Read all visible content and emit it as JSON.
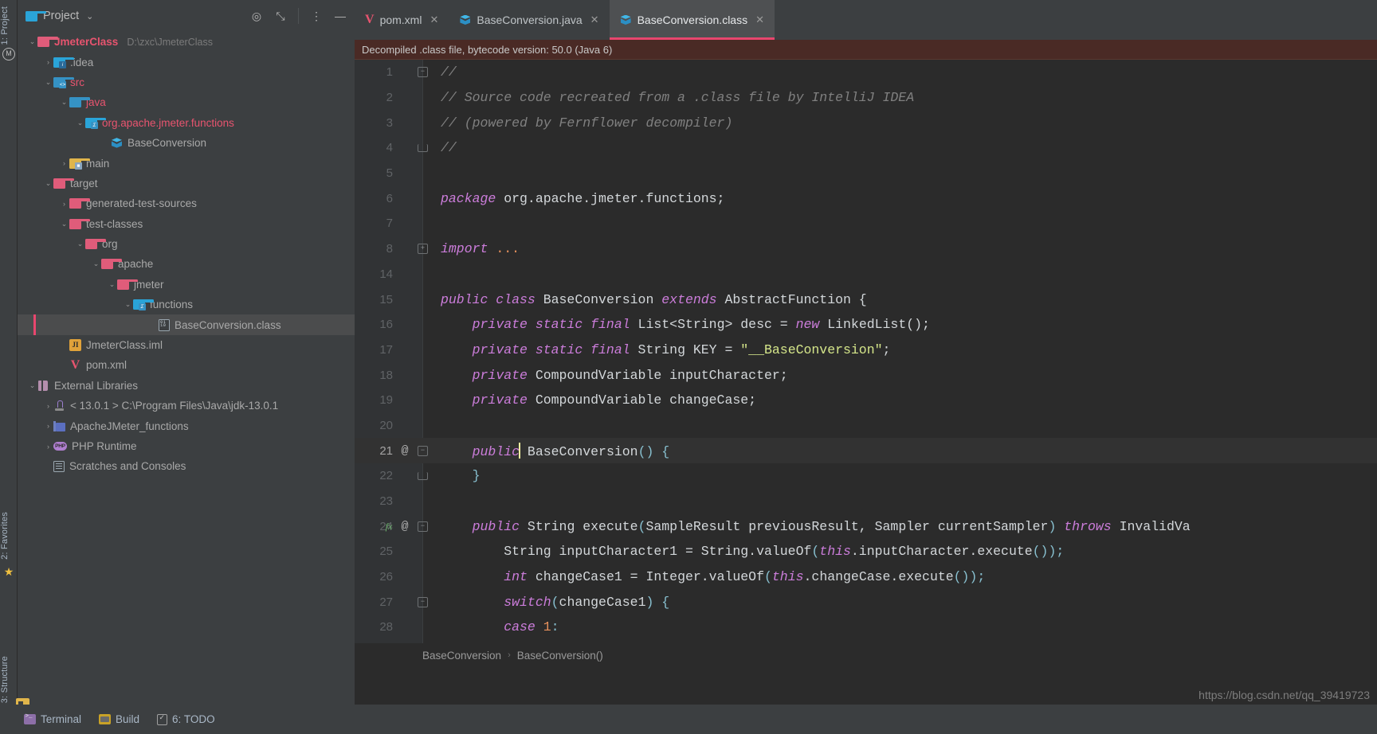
{
  "window": {
    "left_tools": [
      {
        "label": "1: Project",
        "name": "project"
      },
      {
        "label": "2: Favorites",
        "name": "favorites"
      },
      {
        "label": "3: Structure",
        "name": "structure"
      }
    ]
  },
  "project_panel": {
    "title": "Project",
    "actions": {
      "locate": "◎",
      "collapse": "⤡",
      "more": "⋮",
      "minimize": "—"
    },
    "tree": [
      {
        "label": "JmeterClass",
        "sub": "D:\\zxc\\JmeterClass",
        "arrow": "⌄",
        "indent": 12,
        "icon": "folder-pink-outline",
        "style": "red-bold",
        "selected": false
      },
      {
        "label": ".idea",
        "sub": "",
        "arrow": "›",
        "indent": 32,
        "icon": "folder-idea",
        "style": "grey",
        "selected": false
      },
      {
        "label": "src",
        "sub": "",
        "arrow": "⌄",
        "indent": 32,
        "icon": "folder-source",
        "style": "red",
        "selected": false
      },
      {
        "label": "java",
        "sub": "",
        "arrow": "⌄",
        "indent": 52,
        "icon": "folder-blue",
        "style": "red",
        "selected": false
      },
      {
        "label": "org.apache.jmeter.functions",
        "sub": "",
        "arrow": "⌄",
        "indent": 72,
        "icon": "folder-package",
        "style": "red",
        "selected": false
      },
      {
        "label": "BaseConversion",
        "sub": "",
        "arrow": "",
        "indent": 104,
        "icon": "java-class-cube",
        "style": "grey",
        "selected": false
      },
      {
        "label": "main",
        "sub": "",
        "arrow": "›",
        "indent": 52,
        "icon": "folder-test-yellow",
        "style": "grey",
        "selected": false
      },
      {
        "label": "target",
        "sub": "",
        "arrow": "⌄",
        "indent": 32,
        "icon": "folder-pink",
        "style": "grey",
        "selected": false
      },
      {
        "label": "generated-test-sources",
        "sub": "",
        "arrow": "›",
        "indent": 52,
        "icon": "folder-pink",
        "style": "grey",
        "selected": false
      },
      {
        "label": "test-classes",
        "sub": "",
        "arrow": "⌄",
        "indent": 52,
        "icon": "folder-pink",
        "style": "grey",
        "selected": false
      },
      {
        "label": "org",
        "sub": "",
        "arrow": "⌄",
        "indent": 72,
        "icon": "folder-pink",
        "style": "grey",
        "selected": false
      },
      {
        "label": "apache",
        "sub": "",
        "arrow": "⌄",
        "indent": 92,
        "icon": "folder-pink",
        "style": "grey",
        "selected": false
      },
      {
        "label": "jmeter",
        "sub": "",
        "arrow": "⌄",
        "indent": 112,
        "icon": "folder-pink",
        "style": "grey",
        "selected": false
      },
      {
        "label": "functions",
        "sub": "",
        "arrow": "⌄",
        "indent": 132,
        "icon": "folder-package",
        "style": "grey",
        "selected": false
      },
      {
        "label": "BaseConversion.class",
        "sub": "",
        "arrow": "",
        "indent": 164,
        "icon": "class-binary",
        "style": "grey",
        "selected": true
      },
      {
        "label": "JmeterClass.iml",
        "sub": "",
        "arrow": "",
        "indent": 52,
        "icon": "iml-file",
        "style": "grey",
        "selected": false
      },
      {
        "label": "pom.xml",
        "sub": "",
        "arrow": "",
        "indent": 52,
        "icon": "maven-pom",
        "style": "grey",
        "selected": false
      },
      {
        "label": "External Libraries",
        "sub": "",
        "arrow": "⌄",
        "indent": 12,
        "icon": "library-book",
        "style": "grey",
        "selected": false
      },
      {
        "label": "< 13.0.1 >  C:\\Program Files\\Java\\jdk-13.0.1",
        "sub": "",
        "arrow": "›",
        "indent": 32,
        "icon": "jdk-coffee",
        "style": "grey",
        "selected": false
      },
      {
        "label": "ApacheJMeter_functions",
        "sub": "",
        "arrow": "›",
        "indent": 32,
        "icon": "library-blue",
        "style": "grey",
        "selected": false
      },
      {
        "label": "PHP Runtime",
        "sub": "",
        "arrow": "›",
        "indent": 32,
        "icon": "php-runtime",
        "style": "grey",
        "selected": false
      },
      {
        "label": "Scratches and Consoles",
        "sub": "",
        "arrow": "",
        "indent": 32,
        "icon": "scratch-file",
        "style": "grey",
        "selected": false
      }
    ]
  },
  "editor": {
    "tabs": [
      {
        "label": "pom.xml",
        "icon": "maven-icon",
        "active": false,
        "close": "✕"
      },
      {
        "label": "BaseConversion.java",
        "icon": "java-class-icon",
        "active": false,
        "close": "✕"
      },
      {
        "label": "BaseConversion.class",
        "icon": "java-class-icon",
        "active": true,
        "close": "✕"
      }
    ],
    "notice": "Decompiled .class file, bytecode version: 50.0 (Java 6)",
    "lines": [
      {
        "num": "1",
        "gutter_at": false,
        "gutter_override": false,
        "fold": "start",
        "current": false,
        "tokens": [
          {
            "t": "cm",
            "v": "//"
          }
        ]
      },
      {
        "num": "2",
        "gutter_at": false,
        "gutter_override": false,
        "fold": "",
        "current": false,
        "tokens": [
          {
            "t": "cm",
            "v": "// Source code recreated from a .class file by IntelliJ IDEA"
          }
        ]
      },
      {
        "num": "3",
        "gutter_at": false,
        "gutter_override": false,
        "fold": "",
        "current": false,
        "tokens": [
          {
            "t": "cm",
            "v": "// (powered by Fernflower decompiler)"
          }
        ]
      },
      {
        "num": "4",
        "gutter_at": false,
        "gutter_override": false,
        "fold": "end",
        "current": false,
        "tokens": [
          {
            "t": "cm",
            "v": "//"
          }
        ]
      },
      {
        "num": "5",
        "gutter_at": false,
        "gutter_override": false,
        "fold": "",
        "current": false,
        "tokens": []
      },
      {
        "num": "6",
        "gutter_at": false,
        "gutter_override": false,
        "fold": "",
        "current": false,
        "tokens": [
          {
            "t": "k",
            "v": "package"
          },
          {
            "t": "t",
            "v": " org.apache.jmeter.functions;"
          }
        ]
      },
      {
        "num": "7",
        "gutter_at": false,
        "gutter_override": false,
        "fold": "",
        "current": false,
        "tokens": []
      },
      {
        "num": "8",
        "gutter_at": false,
        "gutter_override": false,
        "fold": "plus",
        "current": false,
        "tokens": [
          {
            "t": "k",
            "v": "import"
          },
          {
            "t": "t",
            "v": " "
          },
          {
            "t": "n",
            "v": "..."
          }
        ]
      },
      {
        "num": "14",
        "gutter_at": false,
        "gutter_override": false,
        "fold": "",
        "current": false,
        "tokens": []
      },
      {
        "num": "15",
        "gutter_at": false,
        "gutter_override": false,
        "fold": "",
        "current": false,
        "tokens": [
          {
            "t": "k",
            "v": "public class"
          },
          {
            "t": "t",
            "v": " BaseConversion "
          },
          {
            "t": "k",
            "v": "extends"
          },
          {
            "t": "t",
            "v": " AbstractFunction {"
          }
        ]
      },
      {
        "num": "16",
        "gutter_at": false,
        "gutter_override": false,
        "fold": "",
        "current": false,
        "tokens": [
          {
            "t": "t",
            "v": "    "
          },
          {
            "t": "k",
            "v": "private static final"
          },
          {
            "t": "t",
            "v": " List<String> desc = "
          },
          {
            "t": "k",
            "v": "new"
          },
          {
            "t": "t",
            "v": " LinkedList();"
          }
        ]
      },
      {
        "num": "17",
        "gutter_at": false,
        "gutter_override": false,
        "fold": "",
        "current": false,
        "tokens": [
          {
            "t": "t",
            "v": "    "
          },
          {
            "t": "k",
            "v": "private static final"
          },
          {
            "t": "t",
            "v": " String KEY = "
          },
          {
            "t": "s",
            "v": "\"__BaseConversion\""
          },
          {
            "t": "t",
            "v": ";"
          }
        ]
      },
      {
        "num": "18",
        "gutter_at": false,
        "gutter_override": false,
        "fold": "",
        "current": false,
        "tokens": [
          {
            "t": "t",
            "v": "    "
          },
          {
            "t": "k",
            "v": "private"
          },
          {
            "t": "t",
            "v": " CompoundVariable inputCharacter;"
          }
        ]
      },
      {
        "num": "19",
        "gutter_at": false,
        "gutter_override": false,
        "fold": "",
        "current": false,
        "tokens": [
          {
            "t": "t",
            "v": "    "
          },
          {
            "t": "k",
            "v": "private"
          },
          {
            "t": "t",
            "v": " CompoundVariable changeCase;"
          }
        ]
      },
      {
        "num": "20",
        "gutter_at": false,
        "gutter_override": false,
        "fold": "",
        "current": false,
        "tokens": []
      },
      {
        "num": "21",
        "gutter_at": true,
        "gutter_override": false,
        "fold": "start",
        "current": true,
        "tokens": [
          {
            "t": "t",
            "v": "    "
          },
          {
            "t": "k",
            "v": "public"
          },
          {
            "t": "caret",
            "v": ""
          },
          {
            "t": "t",
            "v": " BaseConversion"
          },
          {
            "t": "p",
            "v": "()"
          },
          {
            "t": "t",
            "v": " "
          },
          {
            "t": "p",
            "v": "{"
          }
        ]
      },
      {
        "num": "22",
        "gutter_at": false,
        "gutter_override": false,
        "fold": "end",
        "current": false,
        "tokens": [
          {
            "t": "t",
            "v": "    "
          },
          {
            "t": "p",
            "v": "}"
          }
        ]
      },
      {
        "num": "23",
        "gutter_at": false,
        "gutter_override": false,
        "fold": "",
        "current": false,
        "tokens": []
      },
      {
        "num": "24",
        "gutter_at": true,
        "gutter_override": true,
        "fold": "start",
        "current": false,
        "tokens": [
          {
            "t": "t",
            "v": "    "
          },
          {
            "t": "k",
            "v": "public"
          },
          {
            "t": "t",
            "v": " String execute"
          },
          {
            "t": "p",
            "v": "("
          },
          {
            "t": "t",
            "v": "SampleResult previousResult, Sampler currentSampler"
          },
          {
            "t": "p",
            "v": ")"
          },
          {
            "t": "t",
            "v": " "
          },
          {
            "t": "k",
            "v": "throws"
          },
          {
            "t": "t",
            "v": " InvalidVa"
          }
        ]
      },
      {
        "num": "25",
        "gutter_at": false,
        "gutter_override": false,
        "fold": "",
        "current": false,
        "tokens": [
          {
            "t": "t",
            "v": "        String inputCharacter1 = String.valueOf"
          },
          {
            "t": "p",
            "v": "("
          },
          {
            "t": "k",
            "v": "this"
          },
          {
            "t": "t",
            "v": ".inputCharacter.execute"
          },
          {
            "t": "p",
            "v": "())"
          },
          {
            "t": "p",
            "v": ";"
          }
        ]
      },
      {
        "num": "26",
        "gutter_at": false,
        "gutter_override": false,
        "fold": "",
        "current": false,
        "tokens": [
          {
            "t": "t",
            "v": "        "
          },
          {
            "t": "k",
            "v": "int"
          },
          {
            "t": "t",
            "v": " changeCase1 = Integer.valueOf"
          },
          {
            "t": "p",
            "v": "("
          },
          {
            "t": "k",
            "v": "this"
          },
          {
            "t": "t",
            "v": ".changeCase.execute"
          },
          {
            "t": "p",
            "v": "())"
          },
          {
            "t": "p",
            "v": ";"
          }
        ]
      },
      {
        "num": "27",
        "gutter_at": false,
        "gutter_override": false,
        "fold": "start",
        "current": false,
        "tokens": [
          {
            "t": "t",
            "v": "        "
          },
          {
            "t": "k",
            "v": "switch"
          },
          {
            "t": "p",
            "v": "("
          },
          {
            "t": "t",
            "v": "changeCase1"
          },
          {
            "t": "p",
            "v": ")"
          },
          {
            "t": "t",
            "v": " "
          },
          {
            "t": "p",
            "v": "{"
          }
        ]
      },
      {
        "num": "28",
        "gutter_at": false,
        "gutter_override": false,
        "fold": "",
        "current": false,
        "tokens": [
          {
            "t": "t",
            "v": "        "
          },
          {
            "t": "k",
            "v": "case"
          },
          {
            "t": "t",
            "v": " "
          },
          {
            "t": "n",
            "v": "1"
          },
          {
            "t": "p",
            "v": ":"
          }
        ]
      }
    ],
    "breadcrumb": [
      "BaseConversion",
      "BaseConversion()"
    ],
    "breadcrumb_sep": "›"
  },
  "watermark": "https://blog.csdn.net/qq_39419723",
  "bottom_bar": [
    {
      "label": "Terminal",
      "icon": "terminal-icon"
    },
    {
      "label": "Build",
      "icon": "build-icon"
    },
    {
      "label": "6: TODO",
      "icon": "todo-icon"
    }
  ]
}
